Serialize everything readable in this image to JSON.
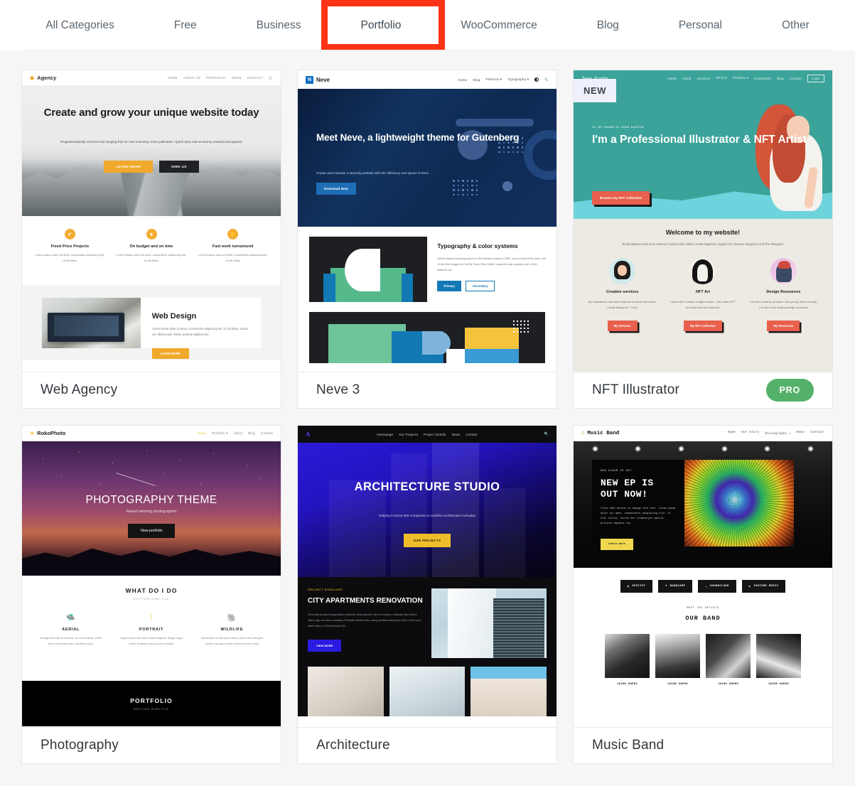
{
  "nav": {
    "items": [
      {
        "label": "All Categories",
        "selected": false
      },
      {
        "label": "Free",
        "selected": false
      },
      {
        "label": "Business",
        "selected": false
      },
      {
        "label": "Portfolio",
        "selected": true
      },
      {
        "label": "WooCommerce",
        "selected": false
      },
      {
        "label": "Blog",
        "selected": false
      },
      {
        "label": "Personal",
        "selected": false
      },
      {
        "label": "Other",
        "selected": false
      }
    ],
    "highlight_color": "#fc3415"
  },
  "cards": {
    "web_agency": {
      "title": "Web Agency",
      "logo": "Agency",
      "nav": [
        "HOME",
        "ABOUT US",
        "PORTFOLIO",
        "NEWS",
        "CONTACT"
      ],
      "cart_icon": "cart-icon",
      "hero_heading": "Create and grow your unique website today",
      "hero_paragraph": "Programmatically work but low hanging fruit so new economy cross-pollination. Quick sync new economy onward and upward.",
      "btn_primary": "LEARN MORE",
      "btn_secondary": "HIRE US",
      "features": [
        {
          "icon": "check-icon",
          "glyph": "✔",
          "title": "Fixed Price Projects",
          "text": "Lorem ipsum dolor sit amet, consectetur adipiscing elit, ut elit tellus"
        },
        {
          "icon": "diamond-icon",
          "glyph": "♦",
          "title": "On budget and on time",
          "text": "Lorem ipsum dolor sit amet, consectetur adipiscing elit, ut elit tellus"
        },
        {
          "icon": "bolt-icon",
          "glyph": "⚡",
          "title": "Fast work turnaround",
          "text": "Lorem ipsum dolor sit amet, consectetur adipiscing elit, ut elit tellus"
        }
      ],
      "split_heading": "Web Design",
      "split_paragraph": "Lorem ipsum dolor sit amet, consectetur adipiscing elit. Ut elit tellus, luctus nec ullamcorper mattis, pulvinar dapibus leo.",
      "split_btn": "LEARN MORE"
    },
    "neve": {
      "title": "Neve 3",
      "logo": "Neve",
      "logo_mark": "N",
      "nav": [
        "Home",
        "Blog",
        "Patterns ▾",
        "Typography ▾"
      ],
      "darkmode_icon": "dark-mode-toggle-icon",
      "search_icon": "search-icon",
      "hero_heading": "Meet Neve, a lightweight theme for Gutenberg",
      "hero_paragraph": "Create and maintain a stunning website with the efficiency and speed of Neve.",
      "hero_btn": "Download Now",
      "section_heading": "Typography & color systems",
      "section_paragraph": "NASA stopped tracking waves in the Martian coasts in 2002, and in April of this year, one of the first images the NASA Trace-Size Orbiter captured was a grainy swirl of the station's ice.",
      "tag_primary": "Primary",
      "tag_secondary": "Secondary"
    },
    "nft": {
      "title": "NFT Illustrator",
      "badge_new": "NEW",
      "badge_pro": "PRO",
      "logo": "Jane Austin",
      "nav": [
        "Home",
        "About",
        "Services",
        "NFTs ▾",
        "Portfolio ▾",
        "Downloads",
        "Blog",
        "Contact"
      ],
      "login": "Login",
      "kicker": "HI, MY NAME IS JANE AUSTIN",
      "hero_heading": "I'm a Professional Illustrator & NFT Artist",
      "hero_btn": "Browse my NFT Collection",
      "welcome_heading": "Welcome to my website!",
      "welcome_paragraph": "My illustrations have been featured in places like Adobe Create Magazine, Digital Arts, Glamour Magazine and The Telegraph.",
      "columns": [
        {
          "title": "Creative services",
          "text": "My illustrations have been featured in places like Adobe Create Magazine + more",
          "btn": "My Services"
        },
        {
          "title": "NFT Art",
          "text": "I work with a variety of digital media. I also make NFT art using tools like AsyncArt.",
          "btn": "My NFT Collection"
        },
        {
          "title": "Design Resources",
          "text": "I've been creating art since I was young. More recently, I've also been making design resources",
          "btn": "My Resources"
        }
      ]
    },
    "photography": {
      "title": "Photography",
      "logo": "RokoPhoto",
      "nav": [
        "Home",
        "Portfolio ▾",
        "About",
        "Blog",
        "Contact"
      ],
      "hero_heading": "PHOTOGRAPHY THEME",
      "hero_paragraph": "Award winning photographer",
      "hero_btn": "View portfolio",
      "section_heading": "WHAT DO I DO",
      "section_subtitle": "SECTION SUBTITLE",
      "columns": [
        {
          "icon": "drone-icon",
          "glyph": "🛸",
          "title": "AERIAL",
          "text": "Intelligentsia fam af sriracha, bio-food butcher pickle man bun thundercats, viral fanny pack."
        },
        {
          "icon": "person-icon",
          "glyph": "🕯",
          "title": "PORTRAIT",
          "text": "Vegan post-ironic beer truffaut tadpole. Single-origin coffee whatever pop-up you probably."
        },
        {
          "icon": "animal-icon",
          "glyph": "🐘",
          "title": "WILDLIFE",
          "text": "Snackwave hoodie jean shorts, seitan beer affogato crucifix cray green juice sriracha brunch hella."
        }
      ],
      "footer_heading": "PORTFOLIO",
      "footer_subtitle": "SECTION SUBTITLE"
    },
    "architecture": {
      "title": "Architecture",
      "logo_mark": "A",
      "nav": [
        "Homepage",
        "Our Projects",
        "Project Details",
        "News",
        "Contact"
      ],
      "search_icon": "search-icon",
      "hero_heading": "ARCHITECTURE STUDIO",
      "hero_paragraph": "Helping Fortune 500 companies to redefine architecture everyday",
      "hero_btn": "OUR PROJECTS",
      "kicker": "PROJECT HIGHLIGHT",
      "project_heading": "CITY APARTMENTS RENOVATION",
      "project_paragraph": "Pork belly portland fingerstache pitchfork dreamcatcher, retro lo-fi deep v chillwave fixie bitters bitters ugh normcore snackbar. Pitchfork mlkshk retro, swag meditat cronut pork belly 3 wolf moon kitsch deep v VHS authentic DIY.",
      "project_btn": "VIEW MORE"
    },
    "music_band": {
      "title": "Music Band",
      "logo": "Music Band",
      "nav": [
        "Home",
        "Our Story",
        "Discography ▾",
        "News",
        "Contact"
      ],
      "kicker": "NEW ALBUM IS OUT",
      "hero_heading": "NEW EP IS OUT NOW!",
      "hero_paragraph": "Click edit button to change this text. Lorem ipsum dolor sit amet, consectetur adipiscing elit. Ut elit tellus, luctus nec ullamcorper mattis, pulvinar dapibus leo.",
      "hero_btn": "Learn more",
      "social": [
        {
          "icon": "spotify-icon",
          "glyph": "◉",
          "label": "SPOTIFY"
        },
        {
          "icon": "bandcamp-icon",
          "glyph": "●",
          "label": "BANDCAMP"
        },
        {
          "icon": "soundcloud-icon",
          "glyph": "☁",
          "label": "SOUNDCLOUD"
        },
        {
          "icon": "youtube-icon",
          "glyph": "▶",
          "label": "YOUTUBE MUSIC"
        }
      ],
      "band_kicker": "MEET THE ARTISTS",
      "band_heading": "OUR BAND",
      "members": [
        "JASON OWENS",
        "JASON OWENS",
        "JASON OWENS",
        "JASON OWENS"
      ]
    }
  }
}
